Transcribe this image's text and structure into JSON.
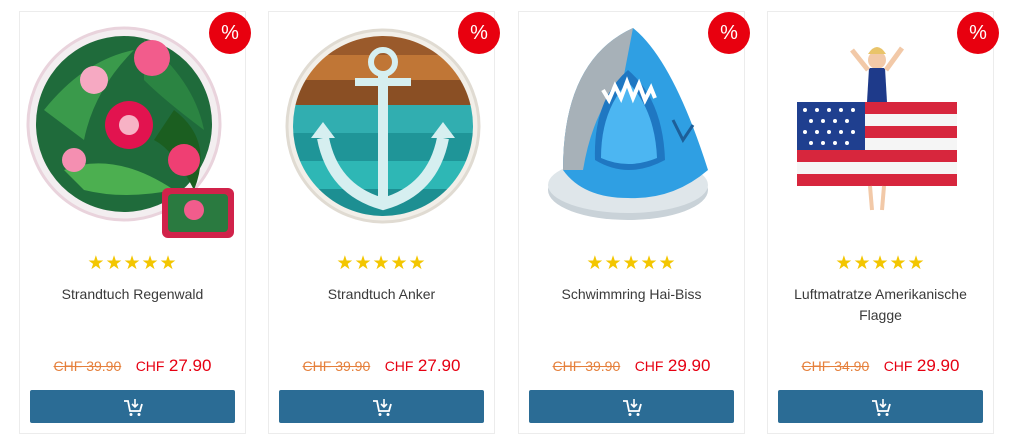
{
  "products": [
    {
      "title": "Strandtuch Regenwald",
      "old_price": "CHF 39.90",
      "currency": "CHF",
      "price": "27.90",
      "badge": "%",
      "rating": 5,
      "stars": "★★★★★"
    },
    {
      "title": "Strandtuch Anker",
      "old_price": "CHF 39.90",
      "currency": "CHF",
      "price": "27.90",
      "badge": "%",
      "rating": 5,
      "stars": "★★★★★"
    },
    {
      "title": "Schwimmring Hai-Biss",
      "old_price": "CHF 39.90",
      "currency": "CHF",
      "price": "29.90",
      "badge": "%",
      "rating": 5,
      "stars": "★★★★★"
    },
    {
      "title": "Luftmatratze Amerikanische Flagge",
      "old_price": "CHF 34.90",
      "currency": "CHF",
      "price": "29.90",
      "badge": "%",
      "rating": 5,
      "stars": "★★★★★"
    }
  ],
  "colors": {
    "badge": "#e8000f",
    "star": "#f3c600",
    "old_price": "#e5803c",
    "price": "#e60012",
    "cart_button": "#2b6c95"
  },
  "icons": {
    "cart_button": "cart-add-icon"
  }
}
